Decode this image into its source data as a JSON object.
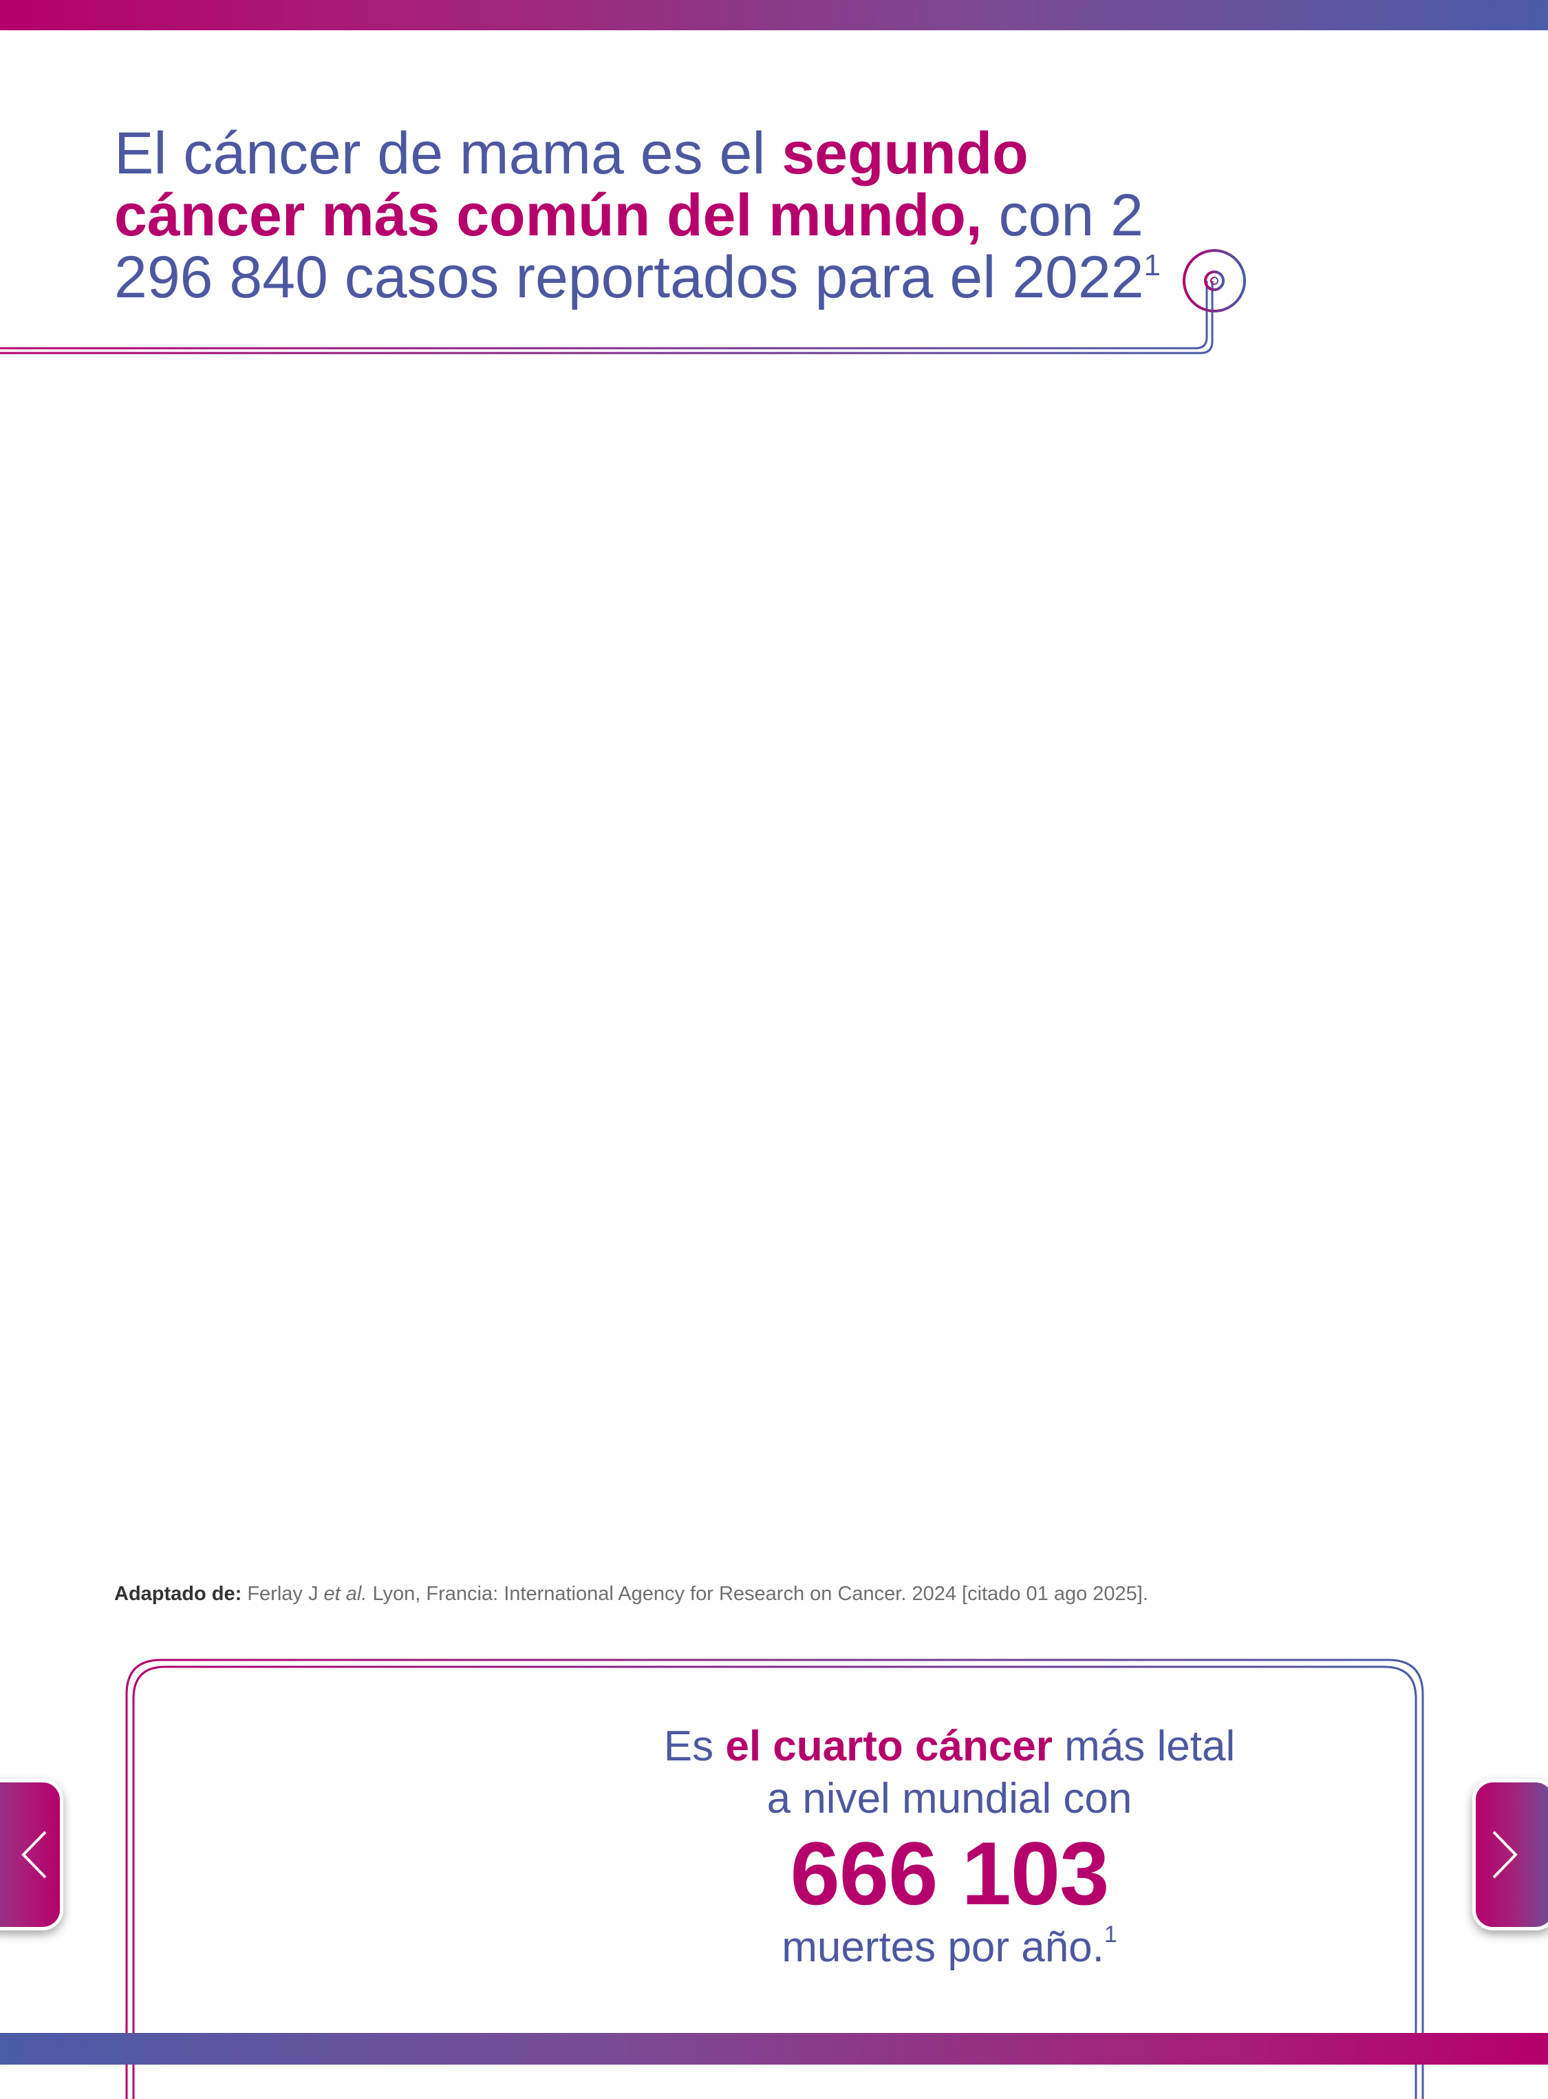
{
  "colors": {
    "magenta": "#b5006b",
    "indigo": "#4d58a0",
    "grey": "#6e6e6e"
  },
  "headline": {
    "part1": "El cáncer de mama es el ",
    "highlight": "segundo cáncer más común del mundo,",
    "part2": " con 2 296 840 casos reportados para el 2022",
    "sup": "1"
  },
  "reference": {
    "label": "Adaptado de:",
    "text_before": " Ferlay J ",
    "italic": "et al.",
    "text_after": " Lyon, Francia: International Agency for Research on Cancer. 2024 [citado 01 ago 2025]."
  },
  "stat": {
    "pre": "Es ",
    "highlight": "el cuarto cáncer",
    "post": " más letal",
    "line2": "a nivel mundial con",
    "number": "666 103",
    "line3": "muertes por año.",
    "sup": "1"
  },
  "nav": {
    "prev_icon": "chevron-left-icon",
    "next_icon": "chevron-right-icon"
  }
}
